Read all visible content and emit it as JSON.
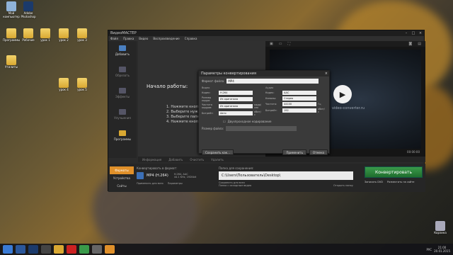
{
  "desktop": {
    "icons": [
      {
        "label": "Мой компьютер"
      },
      {
        "label": "Adobe Photoshop"
      },
      {
        "label": "Программы"
      },
      {
        "label": "Рабочие"
      },
      {
        "label": "Утилиты"
      },
      {
        "label": "урок 1"
      },
      {
        "label": "урок 2"
      },
      {
        "label": "урок 3"
      },
      {
        "label": "урок 4"
      },
      {
        "label": "урок 5"
      },
      {
        "label": "Корзина"
      }
    ]
  },
  "app": {
    "title": "ВидеоМАСТЕР",
    "menu": [
      "Файл",
      "Правка",
      "Видео",
      "Воспроизведение",
      "Справка"
    ],
    "sidebar": [
      "Добавить",
      "Обрезать",
      "Эффекты",
      "Улучшения",
      "Программы"
    ],
    "start_title": "Начало работы:",
    "steps": [
      "1. Нажмите кнопку  Добавить",
      "2. Выберите нужный формат",
      "3. Выберите  папку для сохранения",
      "4. Нажмите кнопку  Конвертировать"
    ],
    "watermark": "video-converter.ru",
    "timecode": "00:00:00",
    "tools": [
      "Информация",
      "Добавить",
      "Очистить",
      "Удалить"
    ],
    "format_tabs": [
      "Форматы",
      "Устройства",
      "Сайты"
    ],
    "format_label": "Конвертировать в формат:",
    "format_name": "MP4 (H.264)",
    "format_specs": [
      "H.264, AAC",
      "44.1 KHz, 192Kbit"
    ],
    "apply_all": "Применить для всех",
    "params": "Параметры",
    "save_label": "Папка для сохранения:",
    "save_path": "C:\\Users\\Пользователь\\Desktop\\",
    "save_opt1": "Сохранить для всех",
    "save_opt2": "Папка с исходным видео",
    "open_folder": "Открыть папку",
    "convert": "Конвертировать",
    "burn_dvd": "Записать DVD",
    "publish": "Разместить на сайте"
  },
  "dialog": {
    "title": "Параметры конвертирования",
    "format_label": "Формат файла:",
    "format_value": "MP4",
    "video_h": "Видео",
    "audio_h": "Аудио",
    "video": [
      {
        "k": "Кодек:",
        "v": "H.264",
        "u": ""
      },
      {
        "k": "Размер кадра:",
        "v": "Из оригинала",
        "u": ""
      },
      {
        "k": "Частота кадров:",
        "v": "Из оригинала",
        "u": "кадр/сек"
      },
      {
        "k": "Битрейт:",
        "v": "Авто",
        "u": "кбит/с"
      }
    ],
    "audio": [
      {
        "k": "Кодек:",
        "v": "AAC",
        "u": ""
      },
      {
        "k": "Каналы:",
        "v": "Стерео",
        "u": ""
      },
      {
        "k": "Частота:",
        "v": "44100",
        "u": "Гц"
      },
      {
        "k": "Битрейт:",
        "v": "192",
        "u": "кбит/с"
      }
    ],
    "two_pass": "Двухпроходное кодирование",
    "size_label": "Размер файла:",
    "save_btn": "Сохранить как...",
    "apply_btn": "Применить",
    "cancel_btn": "Отмена"
  },
  "taskbar": {
    "lang": "РУС",
    "time": "21:00",
    "date": "20.01.2015"
  }
}
